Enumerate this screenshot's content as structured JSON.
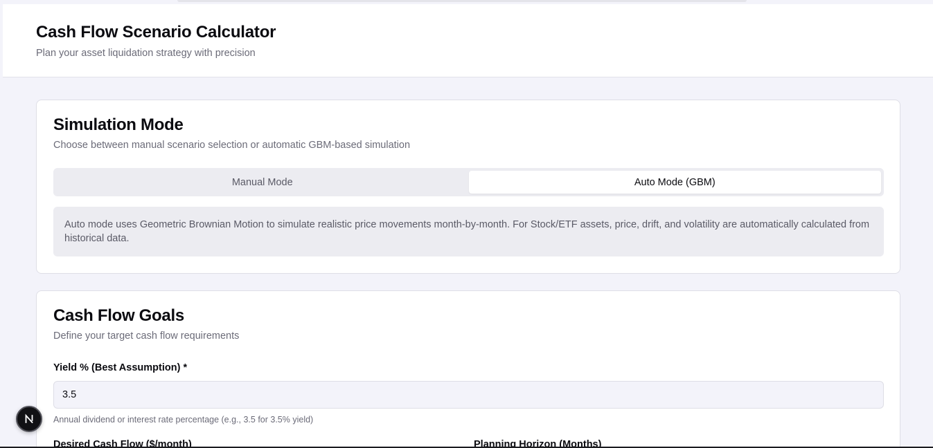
{
  "header": {
    "title": "Cash Flow Scenario Calculator",
    "subtitle": "Plan your asset liquidation strategy with precision"
  },
  "simulation": {
    "title": "Simulation Mode",
    "description": "Choose between manual scenario selection or automatic GBM-based simulation",
    "tabs": [
      {
        "label": "Manual Mode",
        "active": false
      },
      {
        "label": "Auto Mode (GBM)",
        "active": true
      }
    ],
    "info": "Auto mode uses Geometric Brownian Motion to simulate realistic price movements month-by-month. For Stock/ETF assets, price, drift, and volatility are automatically calculated from historical data."
  },
  "goals": {
    "title": "Cash Flow Goals",
    "description": "Define your target cash flow requirements",
    "yield_label": "Yield % (Best Assumption) *",
    "yield_value": "3.5",
    "yield_help": "Annual dividend or interest rate percentage (e.g., 3.5 for 3.5% yield)",
    "desired_label": "Desired Cash Flow ($/month)",
    "horizon_label": "Planning Horizon (Months)"
  },
  "badge": {
    "letter": "N",
    "icon": "nextjs-icon"
  }
}
